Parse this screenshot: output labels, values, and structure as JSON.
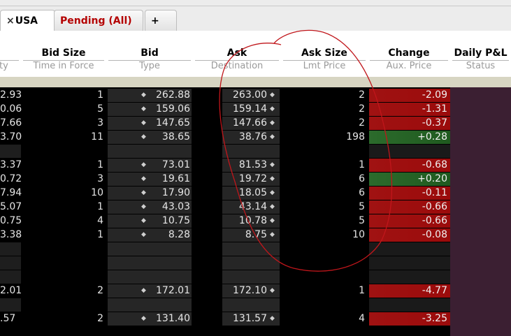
{
  "tabs": [
    {
      "label": "USA",
      "close_glyph": "×",
      "active": true
    },
    {
      "label": "Pending (All)",
      "color": "#b40000"
    },
    {
      "label": "+"
    }
  ],
  "columns": [
    {
      "title": "",
      "sub": "ty"
    },
    {
      "title": "Bid Size",
      "sub": "Time in Force"
    },
    {
      "title": "Bid",
      "sub": "Type"
    },
    {
      "title": "Ask",
      "sub": "Destination"
    },
    {
      "title": "Ask Size",
      "sub": "Lmt Price"
    },
    {
      "title": "Change",
      "sub": "Aux. Price"
    },
    {
      "title": "Daily P&L",
      "sub": "Status"
    }
  ],
  "colors": {
    "change_negative": "#9b0b0b",
    "change_positive": "#1f5a1f",
    "pnl_bg": "#3b1f32",
    "annotation": "#c0161b"
  },
  "rows": [
    {
      "last": "2.93",
      "bid_size": "1",
      "bid": "262.88",
      "ask": "263.00",
      "ask_size": "2",
      "change": "-2.09",
      "dir": "neg"
    },
    {
      "last": "0.06",
      "bid_size": "5",
      "bid": "159.06",
      "ask": "159.14",
      "ask_size": "2",
      "change": "-1.31",
      "dir": "neg"
    },
    {
      "last": "7.66",
      "bid_size": "3",
      "bid": "147.65",
      "ask": "147.66",
      "ask_size": "2",
      "change": "-0.37",
      "dir": "neg"
    },
    {
      "last": "3.70",
      "bid_size": "11",
      "bid": "38.65",
      "ask": "38.76",
      "ask_size": "198",
      "change": "+0.28",
      "dir": "pos"
    },
    {
      "blank": true
    },
    {
      "last": "3.37",
      "bid_size": "1",
      "bid": "73.01",
      "ask": "81.53",
      "ask_size": "1",
      "change": "-0.68",
      "dir": "neg"
    },
    {
      "last": "0.72",
      "bid_size": "3",
      "bid": "19.61",
      "ask": "19.72",
      "ask_size": "6",
      "change": "+0.20",
      "dir": "pos"
    },
    {
      "last": "7.94",
      "bid_size": "10",
      "bid": "17.90",
      "ask": "18.05",
      "ask_size": "6",
      "change": "-0.11",
      "dir": "neg"
    },
    {
      "last": "5.07",
      "bid_size": "1",
      "bid": "43.03",
      "ask": "43.14",
      "ask_size": "5",
      "change": "-0.66",
      "dir": "neg"
    },
    {
      "last": "0.75",
      "bid_size": "4",
      "bid": "10.75",
      "ask": "10.78",
      "ask_size": "5",
      "change": "-0.66",
      "dir": "neg"
    },
    {
      "last": "3.38",
      "bid_size": "1",
      "bid": "8.28",
      "ask": "8.75",
      "ask_size": "10",
      "change": "-0.08",
      "dir": "neg"
    },
    {
      "blank": true
    },
    {
      "blank": true
    },
    {
      "blank": true
    },
    {
      "last": "2.01",
      "bid_size": "2",
      "bid": "172.01",
      "ask": "172.10",
      "ask_size": "1",
      "change": "-4.77",
      "dir": "neg"
    },
    {
      "blank": true
    },
    {
      "last": ".57",
      "bid_size": "2",
      "bid": "131.40",
      "ask": "131.57",
      "ask_size": "4",
      "change": "-3.25",
      "dir": "neg"
    }
  ]
}
